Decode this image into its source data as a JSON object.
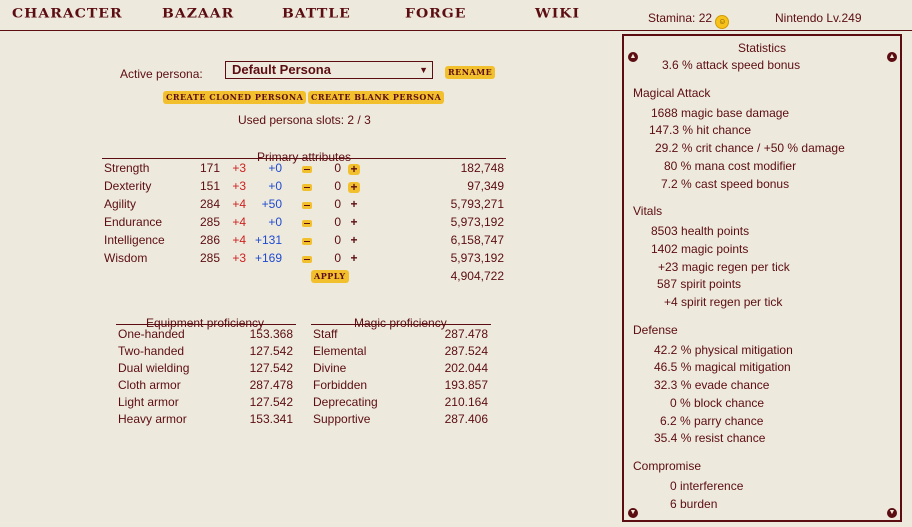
{
  "nav": {
    "character": "CHARACTER",
    "bazaar": "BAZAAR",
    "battle": "BATTLE",
    "forge": "FORGE",
    "wiki": "WIKI"
  },
  "status": {
    "stamina": "Stamina: 22",
    "level": "Nintendo Lv.249"
  },
  "persona": {
    "label": "Active persona:",
    "selected": "Default Persona",
    "rename": "RENAME",
    "create_cloned": "CREATE CLONED PERSONA",
    "create_blank": "CREATE BLANK PERSONA",
    "slots": "Used persona slots: 2 / 3"
  },
  "primary": {
    "title": "Primary attributes",
    "rows": [
      {
        "name": "Strength",
        "base": "171",
        "inc": "+3",
        "bonus": "+0",
        "assigned": "0",
        "exp": "182,748"
      },
      {
        "name": "Dexterity",
        "base": "151",
        "inc": "+3",
        "bonus": "+0",
        "assigned": "0",
        "exp": "97,349"
      },
      {
        "name": "Agility",
        "base": "284",
        "inc": "+4",
        "bonus": "+50",
        "assigned": "0",
        "exp": "5,793,271"
      },
      {
        "name": "Endurance",
        "base": "285",
        "inc": "+4",
        "bonus": "+0",
        "assigned": "0",
        "exp": "5,973,192"
      },
      {
        "name": "Intelligence",
        "base": "286",
        "inc": "+4",
        "bonus": "+131",
        "assigned": "0",
        "exp": "6,158,747"
      },
      {
        "name": "Wisdom",
        "base": "285",
        "inc": "+3",
        "bonus": "+169",
        "assigned": "0",
        "exp": "5,973,192"
      }
    ],
    "apply": "APPLY",
    "remaining": "4,904,722"
  },
  "equipment": {
    "title": "Equipment proficiency",
    "rows": [
      {
        "name": "One-handed",
        "value": "153.368"
      },
      {
        "name": "Two-handed",
        "value": "127.542"
      },
      {
        "name": "Dual wielding",
        "value": "127.542"
      },
      {
        "name": "Cloth armor",
        "value": "287.478"
      },
      {
        "name": "Light armor",
        "value": "127.542"
      },
      {
        "name": "Heavy armor",
        "value": "153.341"
      }
    ]
  },
  "magic": {
    "title": "Magic proficiency",
    "rows": [
      {
        "name": "Staff",
        "value": "287.478"
      },
      {
        "name": "Elemental",
        "value": "287.524"
      },
      {
        "name": "Divine",
        "value": "202.044"
      },
      {
        "name": "Forbidden",
        "value": "193.857"
      },
      {
        "name": "Deprecating",
        "value": "210.164"
      },
      {
        "name": "Supportive",
        "value": "287.406"
      }
    ]
  },
  "stats": {
    "title": "Statistics",
    "top_cut": "3.6 % attack speed bonus",
    "magical_attack": {
      "head": "Magical Attack",
      "lines": [
        "1688 magic base damage",
        "147.3 % hit chance",
        "29.2 % crit chance / +50 % damage",
        "80 % mana cost modifier",
        "7.2 % cast speed bonus"
      ]
    },
    "vitals": {
      "head": "Vitals",
      "lines": [
        "8503 health points",
        "1402 magic points",
        "+23 magic regen per tick",
        "587 spirit points",
        "+4 spirit regen per tick"
      ]
    },
    "defense": {
      "head": "Defense",
      "lines": [
        "42.2 % physical mitigation",
        "46.5 % magical mitigation",
        "32.3 % evade chance",
        "0 % block chance",
        "6.2 % parry chance",
        "35.4 % resist chance"
      ]
    },
    "compromise": {
      "head": "Compromise",
      "lines": [
        "0 interference",
        "6 burden"
      ]
    }
  },
  "colors": {
    "text": "#5c0d12",
    "background": "#ede9dc",
    "button": "#f3c02d",
    "increment": "#cc2222",
    "bonus": "#1f4ad1"
  }
}
